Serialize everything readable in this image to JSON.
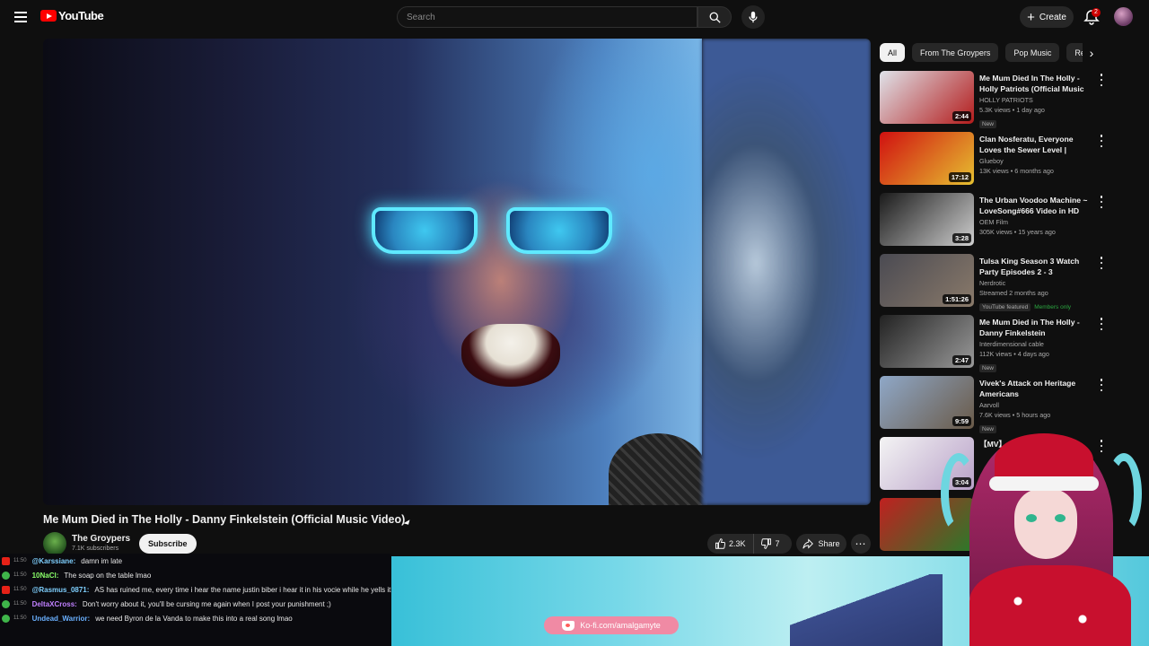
{
  "header": {
    "logo_text": "YouTube",
    "search_placeholder": "Search",
    "create_label": "Create",
    "notification_count": "2"
  },
  "video": {
    "title": "Me Mum Died in The Holly - Danny Finkelstein (Official Music Video)",
    "channel": "The Groypers",
    "subscribers": "7.1K subscribers",
    "subscribe_label": "Subscribe",
    "likes": "2.3K",
    "dislikes": "7",
    "share_label": "Share"
  },
  "chips": [
    "All",
    "From The Groypers",
    "Pop Music",
    "Related"
  ],
  "recommendations": [
    {
      "title": "Me Mum Died In The Holly - Holly Patriots (Official Music ...",
      "channel": "HOLLY PATRIOTS",
      "meta": "5.3K views • 1 day ago",
      "badge": "New",
      "duration": "2:44",
      "thumb_colors": [
        "#dfe3ea",
        "#b31b1b"
      ]
    },
    {
      "title": "Clan Nosferatu, Everyone Loves the Sewer Level | Vampire the ...",
      "channel": "Glueboy",
      "meta": "13K views • 6 months ago",
      "badge": "",
      "duration": "17:12",
      "thumb_colors": [
        "#d01010",
        "#e6c030"
      ]
    },
    {
      "title": "The Urban Voodoo Machine ~ LoveSong#666 Video in HD",
      "channel": "OEM Film",
      "meta": "305K views • 15 years ago",
      "badge": "",
      "duration": "3:28",
      "thumb_colors": [
        "#1a1a1a",
        "#cfcfcf"
      ]
    },
    {
      "title": "Tulsa King Season 3 Watch Party Episodes 2 - 3",
      "channel": "Nerdrotic",
      "meta": "Streamed 2 months ago",
      "badge": "YouTube featured",
      "members": "Members only",
      "duration": "1:51:26",
      "thumb_colors": [
        "#4a4a52",
        "#8a7a6a"
      ]
    },
    {
      "title": "Me Mum Died in The Holly - Danny Finkelstein",
      "channel": "Interdimensional cable",
      "meta": "112K views • 4 days ago",
      "badge": "New",
      "duration": "2:47",
      "thumb_colors": [
        "#222222",
        "#9a9a9a"
      ]
    },
    {
      "title": "Vivek's Attack on Heritage Americans",
      "channel": "Aarvoll",
      "meta": "7.6K views • 5 hours ago",
      "badge": "New",
      "duration": "9:59",
      "thumb_colors": [
        "#8fa8c8",
        "#6a5a48"
      ]
    },
    {
      "title": "【MV】",
      "channel": "",
      "meta": "",
      "badge": "",
      "duration": "3:04",
      "thumb_colors": [
        "#f4f4f4",
        "#b8a0c8"
      ]
    },
    {
      "title": "",
      "channel": "",
      "meta": "",
      "badge": "",
      "duration": "",
      "thumb_colors": [
        "#c02020",
        "#2a7a2a"
      ]
    }
  ],
  "chat": [
    {
      "source": "youtube",
      "time": "11:50",
      "user": "@Karssiane:",
      "user_color": "#7fd0ff",
      "msg": "damn im late"
    },
    {
      "source": "x",
      "time": "11:50",
      "user": "10NaCl:",
      "user_color": "#8aff6a",
      "msg": "The soap on the table lmao"
    },
    {
      "source": "youtube",
      "time": "11:50",
      "user": "@Rasmus_0871:",
      "user_color": "#7fd0ff",
      "msg": "AS has ruined me, every time i hear the name justin biber i hear it in his vocie while he yells it"
    },
    {
      "source": "x",
      "time": "11:50",
      "user": "DeltaXCross:",
      "user_color": "#c080ff",
      "msg": "Don't worry about it, you'll be cursing me again when I post your punishment ;)"
    },
    {
      "source": "x",
      "time": "11:50",
      "user": "Undead_Warrior:",
      "user_color": "#6ab0ff",
      "msg": "we need Byron de la Vanda to make this into a real song lmao"
    }
  ],
  "kofi": "Ko-fi.com/amalgamyte"
}
